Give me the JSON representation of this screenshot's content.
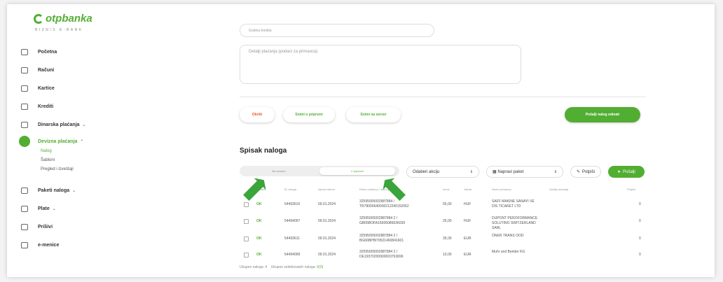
{
  "brand": {
    "name": "otpbanka",
    "sub": "BIZNIS E-BANK"
  },
  "sidebar": {
    "items": [
      {
        "label": "Početna",
        "icon": "grid-icon"
      },
      {
        "label": "Računi",
        "icon": "account-icon"
      },
      {
        "label": "Kartice",
        "icon": "card-icon"
      },
      {
        "label": "Krediti",
        "icon": "credit-icon"
      },
      {
        "label": "Dinarska plaćanja",
        "icon": "payment-icon"
      },
      {
        "label": "Devizna plaćanja",
        "icon": "foreign-payment-icon"
      },
      {
        "label": "Paketi naloga",
        "icon": "package-icon"
      },
      {
        "label": "Plate",
        "icon": "salary-icon"
      },
      {
        "label": "Priliivi",
        "icon": "inflow-icon"
      },
      {
        "label": "e-menice",
        "icon": "emenice-icon"
      }
    ],
    "subitems": [
      "Nalog",
      "Šabloni",
      "Pregled i izveštaji"
    ]
  },
  "form": {
    "godina_placeholder": "Godina kredita",
    "detalji_placeholder": "Detalji plaćanja (podaci za primaoca)"
  },
  "actions": {
    "obrisi": "Obriši",
    "snimi_pripremu": "Snimi u pripremi",
    "snimi_server": "Snimi na server",
    "posalji": "Pošalji nalog odmah"
  },
  "list": {
    "title": "Spisak naloga",
    "tab_server": "Na serveru",
    "tab_priprema": "U pripremi",
    "akcija": "Odaberi akciju",
    "paket": "Napravi paket",
    "potpisi": "Potpiši",
    "posalji": "Pošalji",
    "headers": [
      "Status",
      "ID naloga",
      "Ispravi datum",
      "Račun platioca / račun primaoca",
      "Iznos",
      "Valuta",
      "Naziv primaoca",
      "Detalji plaćanja",
      "Potpisi"
    ],
    "rows": [
      {
        "status": "OK",
        "id": "54493610",
        "date": "09.01.2024",
        "acc1": "32595005002887884 /",
        "acc2": "TR78000640000212240152062",
        "iznos": "55,00",
        "valuta": "HUF",
        "primalac1": "SAFF MAKINE SANAYI VE",
        "primalac2": "DIS TICARET LTD",
        "primalac3": "",
        "potpisi": "0"
      },
      {
        "status": "OK",
        "id": "54494097",
        "date": "09.01.2024",
        "acc1": "32595005002887884 2 /",
        "acc2": "GB05BOFA16606086636039",
        "iznos": "25,00",
        "valuta": "HUF",
        "primalac1": "DUPONT PEROFORMANCE",
        "primalac2": "SOLUTINO SWITZERLAND",
        "primalac3": "SARL",
        "potpisi": "0"
      },
      {
        "status": "OK",
        "id": "54493611",
        "date": "09.01.2024",
        "acc1": "32595005002887884 2 /",
        "acc2": "BG66BPBI79521460841601",
        "iznos": "35,00",
        "valuta": "EUR",
        "primalac1": "ONER TRANS OOD",
        "primalac2": "",
        "primalac3": "",
        "potpisi": "0"
      },
      {
        "status": "OK",
        "id": "54494099",
        "date": "09.01.2024",
        "acc1": "32595005002887884 2 /",
        "acc2": "DE19370200900003763696",
        "iznos": "10,00",
        "valuta": "EUR",
        "primalac1": "Muhr und Bender KG",
        "primalac2": "",
        "primalac3": "",
        "potpisi": "0"
      }
    ],
    "footer_total_label": "Ukupno naloga:",
    "footer_total": "4",
    "footer_selected_label": "Ukupno selektovanih naloga:",
    "footer_selected": "0(0)"
  },
  "colors": {
    "accent": "#52ae32",
    "danger": "#e05a2c"
  }
}
